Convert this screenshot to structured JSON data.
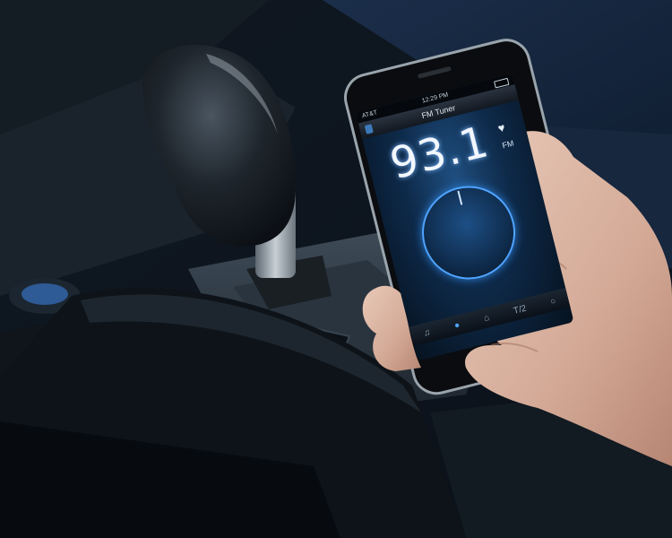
{
  "phone": {
    "status": {
      "carrier": "AT&T",
      "time": "12:29 PM"
    },
    "app_title": "FM Tuner",
    "frequency": "93.1",
    "unit": "FM",
    "tabs": [
      {
        "icon": "music-note-icon",
        "glyph": "♫"
      },
      {
        "icon": "radio-icon",
        "glyph": "●"
      },
      {
        "icon": "bookmark-icon",
        "glyph": "⌂"
      },
      {
        "icon": "mhz-icon",
        "glyph": "T/2"
      },
      {
        "icon": "settings-icon",
        "glyph": "○"
      }
    ]
  },
  "colors": {
    "accent": "#4fa4ff",
    "screen_bg": "#0e2a4a"
  }
}
